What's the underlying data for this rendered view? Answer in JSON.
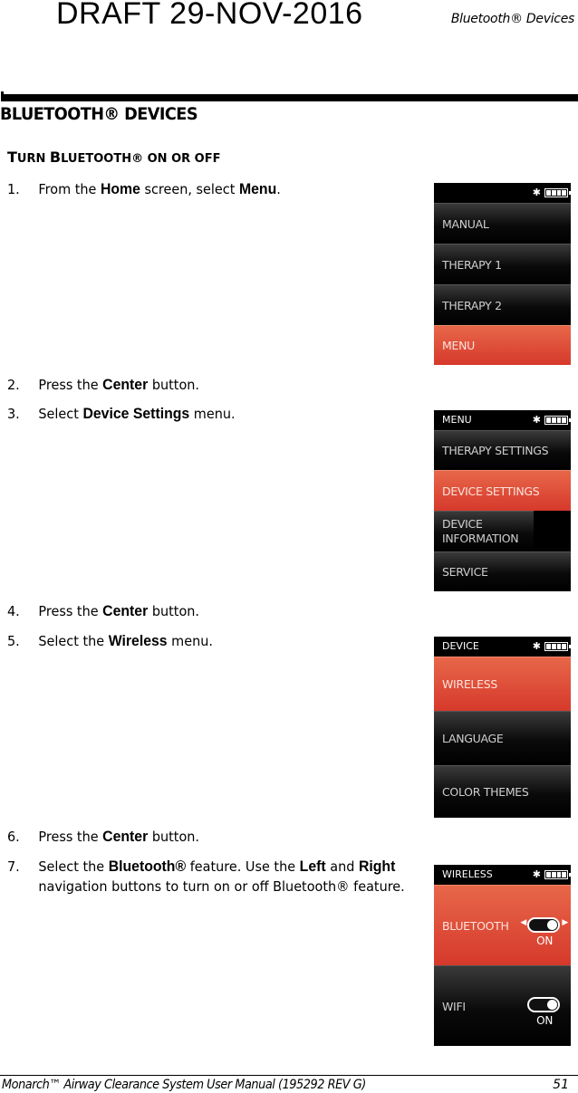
{
  "header": {
    "draft_stamp": "DRAFT 29-NOV-2016",
    "running_head": "Bluetooth® Devices"
  },
  "section": {
    "title": "BLUETOOTH® DEVICES",
    "subtitle_parts": [
      "T",
      "URN ",
      "B",
      "LUETOOTH® ON OR OFF"
    ]
  },
  "steps": [
    {
      "num": "1.",
      "parts": [
        "From the ",
        "Home",
        " screen, select ",
        "Menu",
        "."
      ]
    },
    {
      "num": "2.",
      "parts": [
        "Press the ",
        "Center",
        " button."
      ]
    },
    {
      "num": "3.",
      "parts": [
        "Select ",
        "Device Settings",
        " menu."
      ]
    },
    {
      "num": "4.",
      "parts": [
        "Press the ",
        "Center",
        " button."
      ]
    },
    {
      "num": "5.",
      "parts": [
        "Select the ",
        "Wireless",
        " menu."
      ]
    },
    {
      "num": "6.",
      "parts": [
        "Press the ",
        "Center",
        " button."
      ]
    },
    {
      "num": "7.",
      "parts": [
        "Select the ",
        "Bluetooth®",
        " feature. Use the ",
        "Left",
        " and ",
        "Right",
        " navigation buttons to turn on or off Bluetooth® feature."
      ]
    }
  ],
  "screens": [
    {
      "title": "",
      "items": [
        "MANUAL",
        "THERAPY 1",
        "THERAPY 2",
        "MENU"
      ],
      "selected": 3
    },
    {
      "title": "MENU",
      "items": [
        "THERAPY SETTINGS",
        "DEVICE SETTINGS",
        "DEVICE INFORMATION",
        "SERVICE"
      ],
      "selected": 1
    },
    {
      "title": "DEVICE",
      "items": [
        "WIRELESS",
        "LANGUAGE",
        "COLOR THEMES"
      ],
      "selected": 0
    },
    {
      "title": "WIRELESS",
      "items": [
        {
          "label": "BLUETOOTH",
          "state": "ON"
        },
        {
          "label": "WIFI",
          "state": "ON"
        }
      ],
      "selected": 0
    }
  ],
  "status_icons": {
    "bluetooth": "bluetooth-icon",
    "battery": "battery-icon",
    "bluetooth_glyph": "✱"
  },
  "footer": {
    "manual_title": "Monarch™ Airway Clearance System User Manual (195292 REV G)",
    "page_number": "51"
  }
}
